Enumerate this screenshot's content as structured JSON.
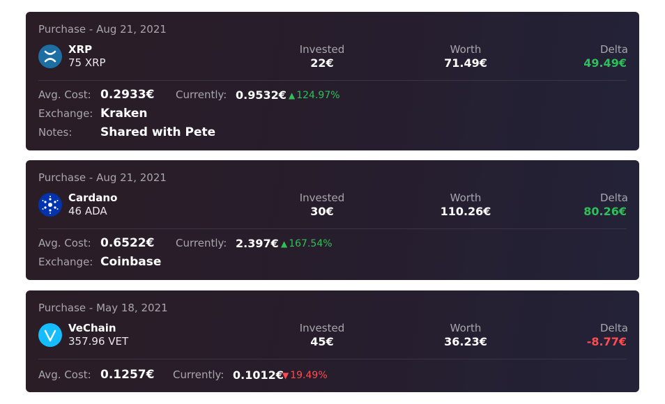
{
  "cards": [
    {
      "purchase": "Purchase - Aug 21, 2021",
      "icon": "xrp-icon",
      "coin": "XRP",
      "amount": "75 XRP",
      "invested_label": "Invested",
      "invested": "22€",
      "worth_label": "Worth",
      "worth": "71.49€",
      "delta_label": "Delta",
      "delta": "49.49€",
      "avg_cost_label": "Avg. Cost:",
      "avg_cost": "0.2933€",
      "currently_label": "Currently:",
      "currently": "0.9532€",
      "change": "124.97%",
      "exchange_label": "Exchange:",
      "exchange": "Kraken",
      "notes_label": "Notes:",
      "notes": "Shared with Pete"
    },
    {
      "purchase": "Purchase - Aug 21, 2021",
      "icon": "cardano-icon",
      "coin": "Cardano",
      "amount": "46 ADA",
      "invested_label": "Invested",
      "invested": "30€",
      "worth_label": "Worth",
      "worth": "110.26€",
      "delta_label": "Delta",
      "delta": "80.26€",
      "avg_cost_label": "Avg. Cost:",
      "avg_cost": "0.6522€",
      "currently_label": "Currently:",
      "currently": "2.397€",
      "change": "167.54%",
      "exchange_label": "Exchange:",
      "exchange": "Coinbase"
    },
    {
      "purchase": "Purchase - May 18, 2021",
      "icon": "vechain-icon",
      "coin": "VeChain",
      "amount": "357.96 VET",
      "invested_label": "Invested",
      "invested": "45€",
      "worth_label": "Worth",
      "worth": "36.23€",
      "delta_label": "Delta",
      "delta": "-8.77€",
      "avg_cost_label": "Avg. Cost:",
      "avg_cost": "0.1257€",
      "currently_label": "Currently:",
      "currently": "0.1012€",
      "change": "19.49%"
    }
  ],
  "colors": {
    "positive": "#2fbf5a",
    "negative": "#ff4c52",
    "xrp": "#1d6fa3",
    "cardano": "#0033ad",
    "vechain": "#15bdff"
  }
}
